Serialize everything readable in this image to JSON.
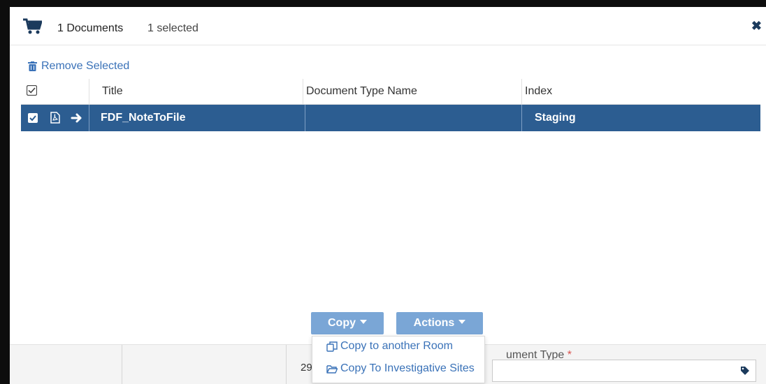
{
  "header": {
    "documents_count": "1 Documents",
    "selected_count": "1 selected",
    "cart_icon": "shopping-cart",
    "close_icon": "close"
  },
  "toolbar": {
    "remove_selected_label": "Remove Selected",
    "remove_icon": "trash"
  },
  "grid": {
    "columns": [
      "Title",
      "Document Type Name",
      "Index"
    ],
    "rows": [
      {
        "selected": true,
        "icons": [
          "checkbox-checked",
          "pdf-file",
          "arrow-right"
        ],
        "title": "FDF_NoteToFile",
        "document_type_name": "",
        "index": "Staging"
      }
    ]
  },
  "buttons": {
    "copy_label": "Copy",
    "actions_label": "Actions"
  },
  "copy_menu": {
    "items": [
      {
        "label": "Copy to another Room",
        "icon": "copy-icon"
      },
      {
        "label": "Copy To Investigative Sites",
        "icon": "folder-open-icon"
      }
    ]
  },
  "background_form": {
    "doc_type_label_partial": "ument Type",
    "required_marker": "*",
    "partial_value": "29"
  },
  "colors": {
    "selected_row": "#2c5d91",
    "button_bg": "#7aa6d6",
    "link": "#3a72b8"
  }
}
